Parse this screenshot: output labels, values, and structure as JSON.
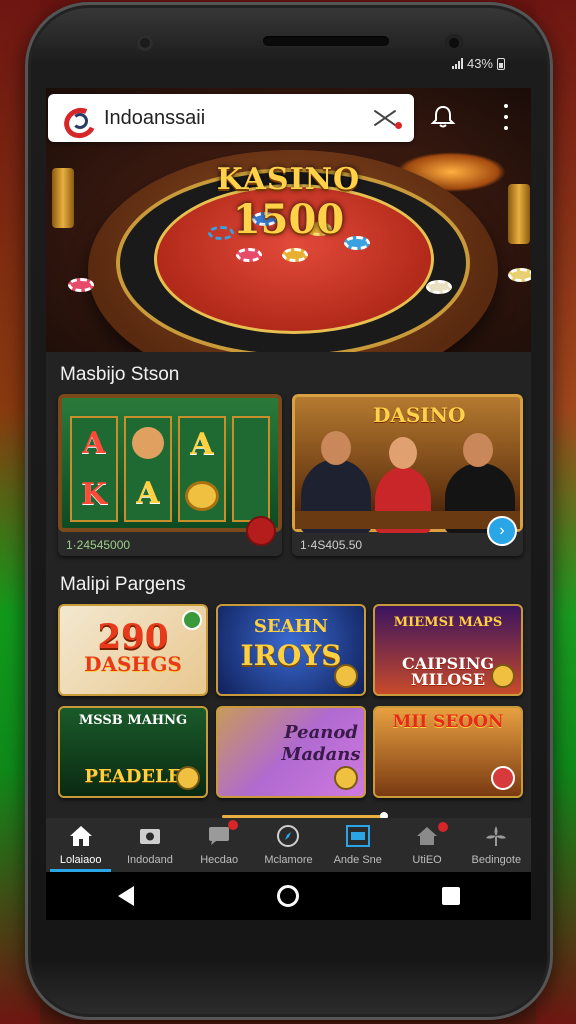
{
  "status_bar": {
    "battery_text": "43%"
  },
  "browser": {
    "url": "Indoanssaii"
  },
  "hero": {
    "title_line1": "KASINO",
    "title_line2": "1500"
  },
  "section1": {
    "title": "Masbijo Stson",
    "cards": [
      {
        "caption": "1·24545000",
        "reels": [
          "A",
          "K",
          "A",
          "A"
        ]
      },
      {
        "caption": "1·4S405.50",
        "art_title": "DASINO"
      }
    ]
  },
  "section2": {
    "title": "Malipi Pargens",
    "tiles": [
      {
        "line1": "290",
        "line2": "DASHGS"
      },
      {
        "line1": "SEAHN",
        "line2": "IROYS"
      },
      {
        "line1": "MIEMSI MAPS",
        "line2": "CAIPSING MILOSE"
      },
      {
        "line1": "MSSB MAHNG",
        "line2": "PEADELE"
      },
      {
        "line1": "Peanod",
        "line2": "Madans"
      },
      {
        "line1": "MII SEOON",
        "line2": ""
      }
    ]
  },
  "bottom_nav": {
    "items": [
      {
        "label": "Lolaiaoo",
        "icon": "home-icon"
      },
      {
        "label": "Indodand",
        "icon": "wallet-icon"
      },
      {
        "label": "Hecdao",
        "icon": "chat-icon"
      },
      {
        "label": "Mclamore",
        "icon": "compass-icon"
      },
      {
        "label": "Ande Sne",
        "icon": "screen-icon"
      },
      {
        "label": "UtiEO",
        "icon": "home-alert-icon"
      },
      {
        "label": "Bedingote",
        "icon": "settings-icon"
      }
    ]
  },
  "colors": {
    "accent": "#2aa6e6",
    "gold": "#ffd24a",
    "brand_red": "#d6262a",
    "background": "#232323"
  }
}
